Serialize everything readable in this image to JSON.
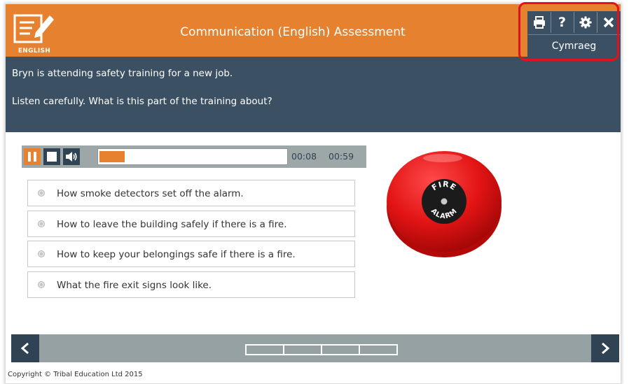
{
  "header": {
    "logo_label": "ENGLISH",
    "title": "Communication (English) Assessment"
  },
  "tools": {
    "print": "print-icon",
    "help": "help-icon",
    "settings": "gear-icon",
    "close": "close-icon",
    "language_button": "Cymraeg"
  },
  "question": {
    "context": "Bryn is attending safety training for a new job.",
    "prompt": "Listen carefully. What is this part of the training about?"
  },
  "player": {
    "current_time": "00:08",
    "total_time": "00:59",
    "progress_fraction": 0.136
  },
  "options": [
    "How smoke detectors set off the alarm.",
    "How to leave the building safely if there is a fire.",
    "How to keep your belongings safe if there is a fire.",
    "What the fire exit signs look like."
  ],
  "image": {
    "bell_text_top": "FIRE",
    "bell_text_bottom": "ALARM"
  },
  "navigation": {
    "prev": "<",
    "next": ">",
    "step_count": 4
  },
  "footer": {
    "copyright": "Copyright © Tribal Education Ltd 2015"
  },
  "colors": {
    "accent": "#e6812f",
    "dark": "#3b5063",
    "highlight": "#e0121f"
  }
}
